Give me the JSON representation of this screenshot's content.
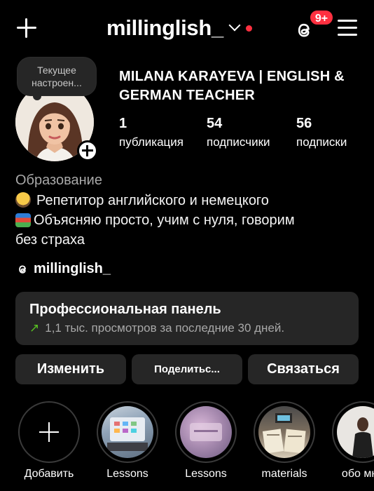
{
  "header": {
    "username": "millinglish_",
    "notification_badge": "9+",
    "accent_color": "#ff3040"
  },
  "profile": {
    "note": "Текущее настроен...",
    "full_name": "MILANA KARAYEVA | ENGLISH & GERMAN TEACHER",
    "stats": [
      {
        "value": "1",
        "label": "публикация"
      },
      {
        "value": "54",
        "label": "подписчики"
      },
      {
        "value": "56",
        "label": "подписки"
      }
    ],
    "category": "Образование",
    "bio": [
      {
        "emoji": "teacher",
        "text": "Репетитор английского и немецкого"
      },
      {
        "emoji": "books",
        "text": "Объясняю просто, учим с нуля, говорим"
      },
      {
        "emoji": "",
        "text": "без страха"
      }
    ],
    "threads_handle": "millinglish_"
  },
  "pro_panel": {
    "title": "Профессиональная панель",
    "subtitle": "1,1 тыс. просмотров за последние 30 дней.",
    "trend_color": "#58c322"
  },
  "actions": {
    "edit_label": "Изменить",
    "share_label": "Поделитьс...",
    "contact_label": "Связаться"
  },
  "highlights": [
    {
      "label": "Добавить",
      "type": "add"
    },
    {
      "label": "Lessons",
      "type": "story"
    },
    {
      "label": "Lessons",
      "type": "story"
    },
    {
      "label": "materials",
      "type": "story"
    },
    {
      "label": "обо мне",
      "type": "story"
    }
  ]
}
